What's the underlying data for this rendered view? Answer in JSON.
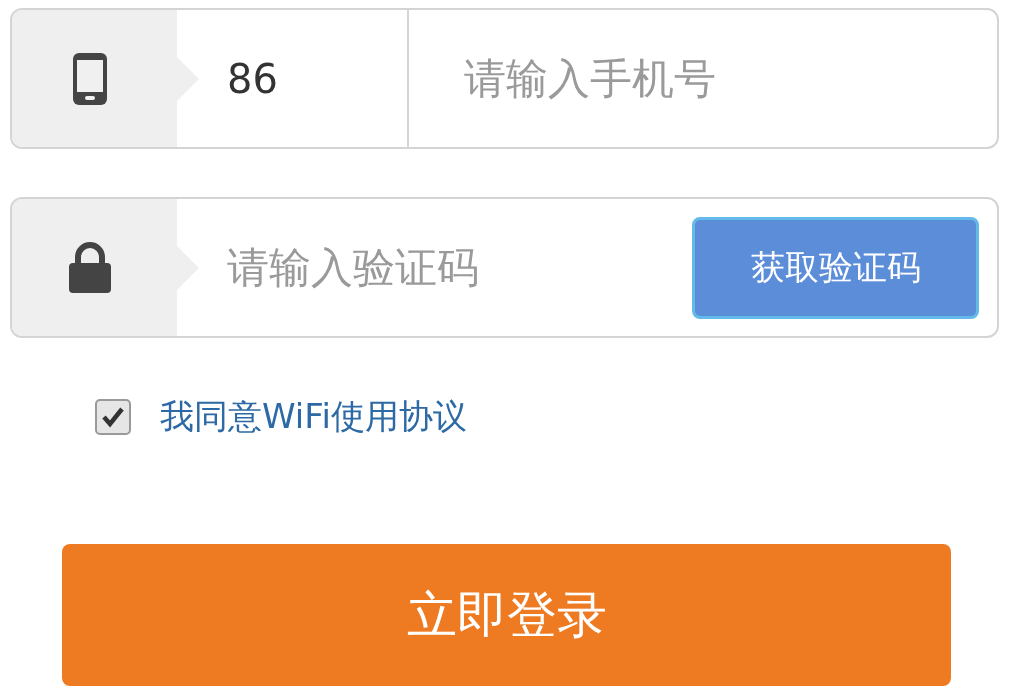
{
  "phone_row": {
    "country_code": "86",
    "placeholder": "请输入手机号"
  },
  "code_row": {
    "placeholder": "请输入验证码",
    "button": "获取验证码"
  },
  "agreement": {
    "checked": true,
    "label": "我同意WiFi使用协议"
  },
  "login_button": "立即登录"
}
